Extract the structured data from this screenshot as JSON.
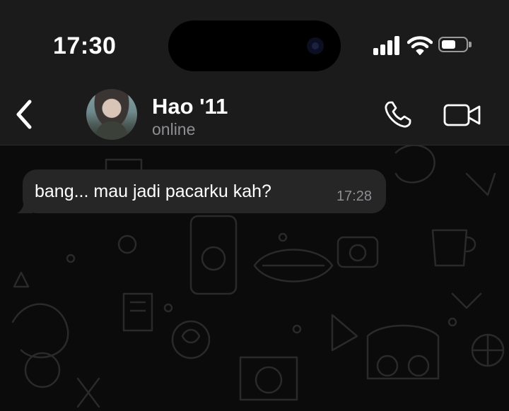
{
  "status_bar": {
    "time": "17:30",
    "icons": [
      "cellular-signal-icon",
      "wifi-icon",
      "battery-icon"
    ]
  },
  "header": {
    "back_icon": "chevron-left-icon",
    "contact_name": "Hao '11",
    "contact_status": "online",
    "actions": [
      "phone-icon",
      "video-camera-icon"
    ]
  },
  "messages": [
    {
      "direction": "incoming",
      "text": "bang... mau jadi pacarku kah?",
      "time": "17:28"
    }
  ],
  "colors": {
    "header_bg": "#1b1b1b",
    "chat_bg": "#0b0b0b",
    "bubble_incoming": "#262626",
    "secondary_text": "#8e8e93"
  }
}
